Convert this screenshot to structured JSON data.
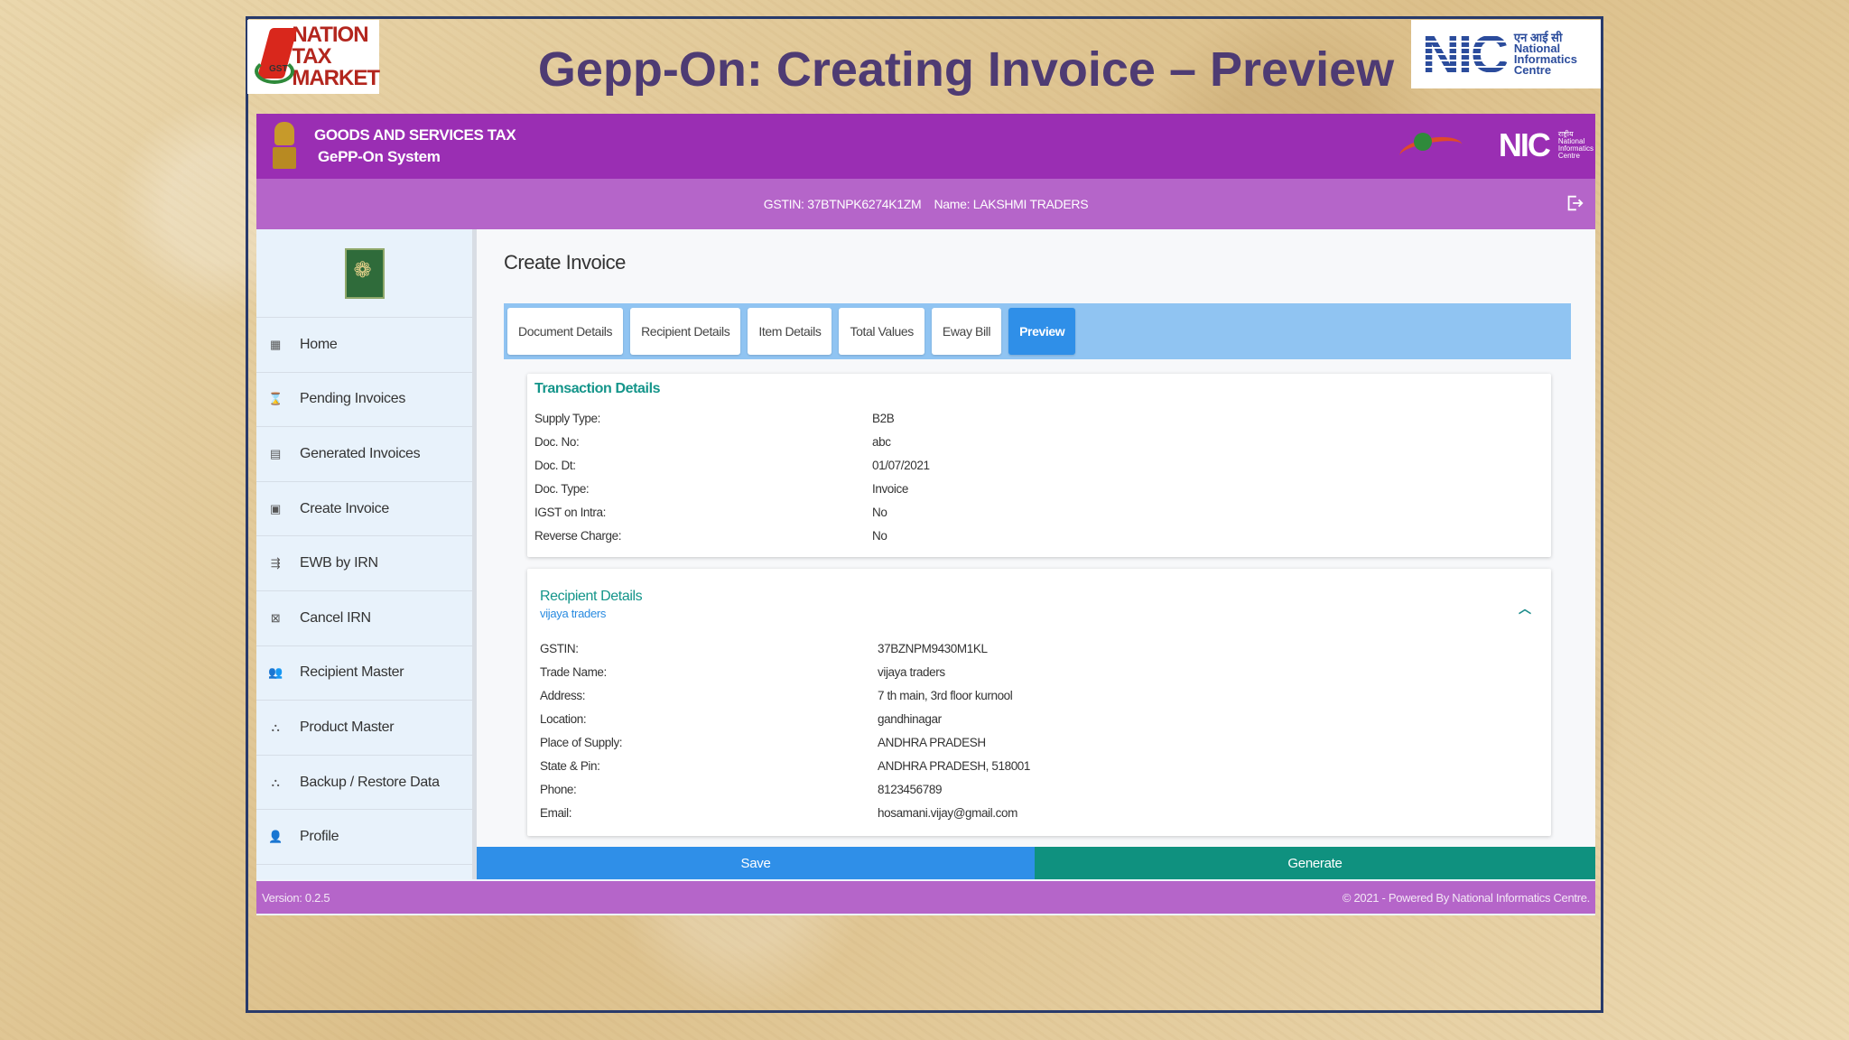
{
  "slide": {
    "title": "Gepp-On: Creating Invoice – Preview",
    "logo_left": [
      "NATION",
      "TAX",
      "MARKET"
    ],
    "logo_left_mark": "GST",
    "logo_right": {
      "name": "NIC",
      "hindi": "एन आई सी",
      "lines": [
        "National",
        "Informatics",
        "Centre"
      ]
    }
  },
  "header": {
    "line1": "GOODS AND SERVICES TAX",
    "line2": "GePP-On System",
    "logo_nic": "NIC",
    "logo_nic_text": [
      "राष्ट्रीय",
      "National",
      "Informatics",
      "Centre"
    ]
  },
  "subheader": {
    "gstin": "GSTIN: 37BTNPK6274K1ZM",
    "name": "Name: LAKSHMI TRADERS"
  },
  "sidebar": {
    "items": [
      {
        "label": "Home",
        "icon": "▦"
      },
      {
        "label": "Pending Invoices",
        "icon": "⌛"
      },
      {
        "label": "Generated Invoices",
        "icon": "▤"
      },
      {
        "label": "Create Invoice",
        "icon": "▣"
      },
      {
        "label": "EWB by IRN",
        "icon": "⇶"
      },
      {
        "label": "Cancel IRN",
        "icon": "⊠"
      },
      {
        "label": "Recipient Master",
        "icon": "👥"
      },
      {
        "label": "Product Master",
        "icon": "⛬"
      },
      {
        "label": "Backup / Restore Data",
        "icon": "⛬"
      },
      {
        "label": "Profile",
        "icon": "👤"
      }
    ]
  },
  "main": {
    "page_title": "Create Invoice",
    "tabs": [
      "Document Details",
      "Recipient Details",
      "Item Details",
      "Total Values",
      "Eway Bill",
      "Preview"
    ],
    "active_tab": "Preview"
  },
  "transaction": {
    "title": "Transaction Details",
    "rows": [
      {
        "label": "Supply Type:",
        "value": "B2B"
      },
      {
        "label": "Doc. No:",
        "value": "abc"
      },
      {
        "label": "Doc. Dt:",
        "value": "01/07/2021"
      },
      {
        "label": "Doc. Type:",
        "value": "Invoice"
      },
      {
        "label": "IGST on Intra:",
        "value": "No"
      },
      {
        "label": "Reverse Charge:",
        "value": "No"
      }
    ]
  },
  "recipient": {
    "title": "Recipient Details",
    "subtitle": "vijaya traders",
    "rows": [
      {
        "label": "GSTIN:",
        "value": "37BZNPM9430M1KL"
      },
      {
        "label": "Trade Name:",
        "value": "vijaya traders"
      },
      {
        "label": "Address:",
        "value": "7 th main, 3rd floor kurnool"
      },
      {
        "label": "Location:",
        "value": "gandhinagar"
      },
      {
        "label": "Place of Supply:",
        "value": "ANDHRA PRADESH"
      },
      {
        "label": "State & Pin:",
        "value": "ANDHRA PRADESH,  518001"
      },
      {
        "label": "Phone:",
        "value": "8123456789"
      },
      {
        "label": "Email:",
        "value": "hosamani.vijay@gmail.com"
      }
    ]
  },
  "actions": {
    "save": "Save",
    "generate": "Generate"
  },
  "footer": {
    "version": "Version: 0.2.5",
    "copyright": "© 2021 - Powered By National Informatics Centre."
  },
  "colors": {
    "header": "#9a2eb3",
    "subheader": "#b565c9",
    "tabs_bar": "#90c4f2",
    "save": "#2f8fe8",
    "generate": "#0f917f",
    "title": "#4e3b73"
  }
}
